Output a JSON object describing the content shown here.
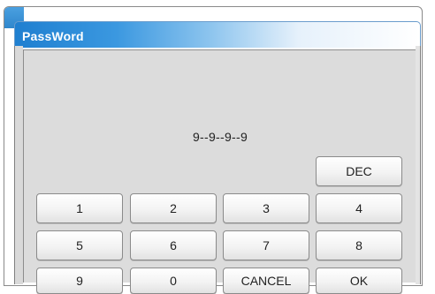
{
  "dialog": {
    "title": "PassWord",
    "display_value": "9--9--9--9"
  },
  "keypad": {
    "dec_label": "DEC",
    "key_1": "1",
    "key_2": "2",
    "key_3": "3",
    "key_4": "4",
    "key_5": "5",
    "key_6": "6",
    "key_7": "7",
    "key_8": "8",
    "key_9": "9",
    "key_0": "0",
    "cancel_label": "CANCEL",
    "ok_label": "OK"
  },
  "colors": {
    "title_bar_start": "#1f7fd0",
    "title_bar_end": "#ffffff",
    "panel_background": "#dcdcdc",
    "button_face": "#f3f3f3"
  }
}
